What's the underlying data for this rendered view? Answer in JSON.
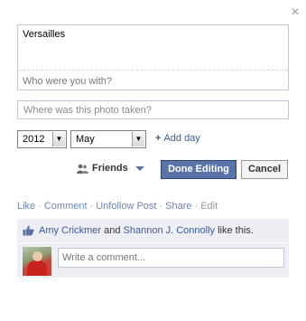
{
  "dialog": {
    "close_glyph": "×"
  },
  "caption": {
    "text": "Versailles",
    "with_placeholder": "Who were you with?"
  },
  "location": {
    "placeholder": "Where was this photo taken?"
  },
  "date": {
    "year": "2012",
    "month": "May",
    "add_day_label": "Add day",
    "add_day_plus": "+"
  },
  "audience": {
    "label": "Friends",
    "icon": "people-icon"
  },
  "buttons": {
    "done": "Done Editing",
    "cancel": "Cancel"
  },
  "actions": {
    "like": "Like",
    "comment": "Comment",
    "unfollow": "Unfollow Post",
    "share": "Share",
    "edit": "Edit",
    "sep": "·"
  },
  "likes": {
    "person1": "Amy Crickmer",
    "and": " and ",
    "person2": "Shannon J. Connolly",
    "suffix": " like this.",
    "icon": "thumbs-up-icon"
  },
  "comment": {
    "placeholder": "Write a comment..."
  },
  "colors": {
    "link": "#3b5998",
    "primary_button": "#5b74a8",
    "feedback_bg": "#edeff4"
  }
}
